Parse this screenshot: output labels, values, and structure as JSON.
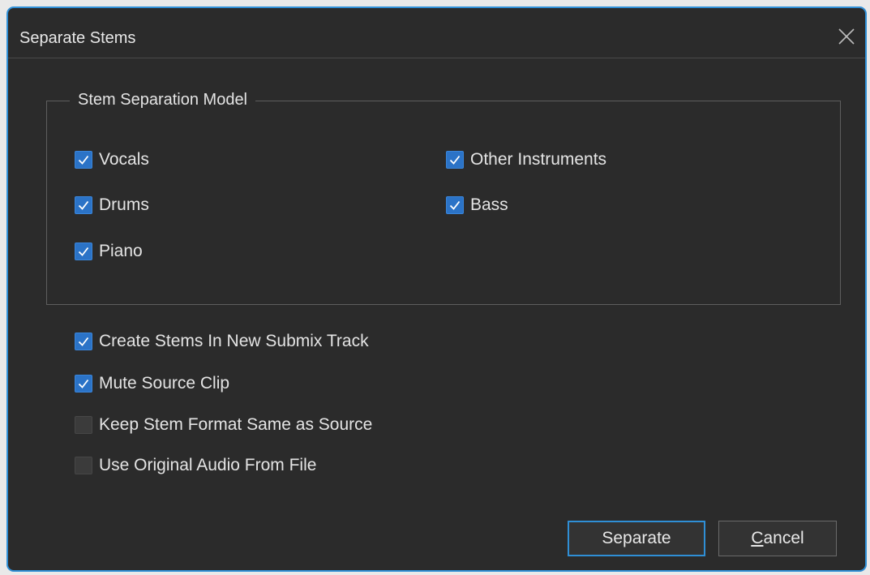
{
  "dialog": {
    "title": "Separate Stems"
  },
  "model_group": {
    "label": "Stem Separation Model",
    "stems": [
      {
        "label": "Vocals",
        "checked": true
      },
      {
        "label": "Drums",
        "checked": true
      },
      {
        "label": "Piano",
        "checked": true
      },
      {
        "label": "Other Instruments",
        "checked": true
      },
      {
        "label": "Bass",
        "checked": true
      }
    ]
  },
  "options": [
    {
      "label": "Create Stems In New Submix Track",
      "checked": true
    },
    {
      "label": "Mute Source Clip",
      "checked": true
    },
    {
      "label": "Keep Stem Format Same as Source",
      "checked": false
    },
    {
      "label": "Use Original Audio From File",
      "checked": false
    }
  ],
  "buttons": {
    "separate": "Separate",
    "cancel_first": "C",
    "cancel_rest": "ancel"
  },
  "colors": {
    "accent": "#2f8fd6",
    "checkbox_checked": "#2b73c7",
    "background": "#2b2b2b"
  },
  "icons": {
    "close": "close-icon",
    "check": "checkmark-icon"
  }
}
